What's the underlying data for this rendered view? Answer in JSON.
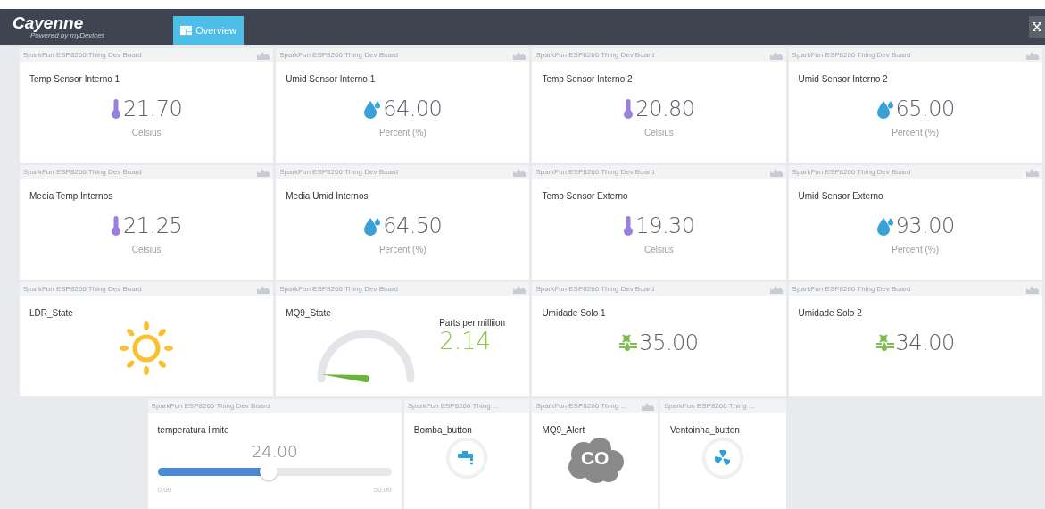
{
  "header": {
    "logo": "Cayenne",
    "tagline": "Powered by myDevices",
    "tabs": [
      {
        "label": "Overview",
        "selected": true
      }
    ]
  },
  "widgets": [
    {
      "kind": "temperature",
      "device": "SparkFun ESP8266 Thing Dev Board",
      "has_chart": true,
      "title": "Temp Sensor Interno 1",
      "value": "21.70",
      "unit": "Celsius"
    },
    {
      "kind": "humidity",
      "device": "SparkFun ESP8266 Thing Dev Board",
      "has_chart": true,
      "title": "Umid Sensor Interno 1",
      "value": "64.00",
      "unit": "Percent (%)"
    },
    {
      "kind": "temperature",
      "device": "SparkFun ESP8266 Thing Dev Board",
      "has_chart": true,
      "title": "Temp Sensor Interno 2",
      "value": "20.80",
      "unit": "Celsius"
    },
    {
      "kind": "humidity",
      "device": "SparkFun ESP8266 Thing Dev Board",
      "has_chart": true,
      "title": "Umid Sensor Interno 2",
      "value": "65.00",
      "unit": "Percent (%)"
    },
    {
      "kind": "temperature",
      "device": "SparkFun ESP8266 Thing Dev Board",
      "has_chart": true,
      "title": "Media Temp Internos",
      "value": "21.25",
      "unit": "Celsius"
    },
    {
      "kind": "humidity",
      "device": "SparkFun ESP8266 Thing Dev Board",
      "has_chart": true,
      "title": "Media Umid Internos",
      "value": "64.50",
      "unit": "Percent (%)"
    },
    {
      "kind": "temperature",
      "device": "SparkFun ESP8266 Thing Dev Board",
      "has_chart": true,
      "title": "Temp Sensor Externo",
      "value": "19.30",
      "unit": "Celsius"
    },
    {
      "kind": "humidity",
      "device": "SparkFun ESP8266 Thing Dev Board",
      "has_chart": true,
      "title": "Umid Sensor Externo",
      "value": "93.00",
      "unit": "Percent (%)"
    },
    {
      "kind": "light",
      "device": "SparkFun ESP8266 Thing Dev Board",
      "has_chart": true,
      "title": "LDR_State"
    },
    {
      "kind": "gauge",
      "device": "SparkFun ESP8266 Thing Dev Board",
      "has_chart": true,
      "title": "MQ9_State",
      "unit": "Parts per milliion",
      "value": "2.14"
    },
    {
      "kind": "soil",
      "device": "SparkFun ESP8266 Thing Dev Board",
      "has_chart": true,
      "title": "Umidade Solo 1",
      "value": "35.00"
    },
    {
      "kind": "soil",
      "device": "SparkFun ESP8266 Thing Dev Board",
      "has_chart": true,
      "title": "Umidade Solo 2",
      "value": "34.00"
    },
    {
      "kind": "slider",
      "device": "SparkFun ESP8266 Thing Dev Board",
      "has_chart": false,
      "title": "temperatura limite",
      "value": "24.00",
      "min": "0.00",
      "max": "50.00",
      "level": 0.48
    },
    {
      "kind": "pump_button",
      "device": "SparkFun ESP8266 Thing ...",
      "has_chart": false,
      "title": "Bomba_button"
    },
    {
      "kind": "alert",
      "device": "SparkFun ESP8266 Thing ...",
      "has_chart": true,
      "title": "MQ9_Alert",
      "label": "CO"
    },
    {
      "kind": "fan_button",
      "device": "SparkFun ESP8266 Thing ...",
      "has_chart": false,
      "title": "Ventoinha_button"
    }
  ]
}
